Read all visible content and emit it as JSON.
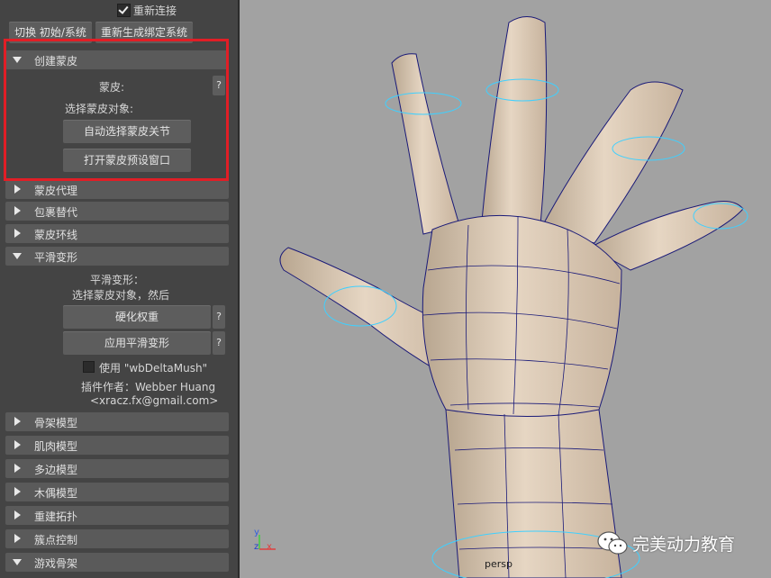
{
  "top": {
    "reconnect_label": "重新连接",
    "switch_button": "切换 初始/系统",
    "regenerate_button": "重新生成绑定系统"
  },
  "sections": {
    "create_skin": {
      "title": "创建蒙皮",
      "skin_label": "蒙皮:",
      "help": "?",
      "select_hint": "选择蒙皮对象:",
      "auto_select_button": "自动选择蒙皮关节",
      "open_preset_button": "打开蒙皮预设窗口"
    },
    "proxy": {
      "title": "蒙皮代理"
    },
    "wrap": {
      "title": "包裹替代"
    },
    "loop": {
      "title": "蒙皮环线"
    },
    "smooth": {
      "title": "平滑变形",
      "line1": "平滑变形：",
      "line2": "选择蒙皮对象，然后",
      "harden_button": "硬化权重",
      "apply_button": "应用平滑变形",
      "help1": "?",
      "help2": "?",
      "use_checkbox_label": "使用 \"wbDeltaMush\"",
      "author_line": "插件作者：Webber Huang",
      "email_line": "<xracz.fx@gmail.com>"
    },
    "collapsed": [
      "骨架模型",
      "肌肉模型",
      "多边模型",
      "木偶模型",
      "重建拓扑",
      "簇点控制",
      "游戏骨架"
    ]
  },
  "viewport": {
    "camera_label": "persp",
    "axis_x": "x",
    "axis_y": "y",
    "axis_z": "z"
  },
  "watermark": {
    "text": "完美动力教育"
  },
  "colors": {
    "highlight_box": "#e11e26",
    "skin": "#dccbb7",
    "wire": "#1a1a78",
    "control_curve": "#3fd0ff"
  }
}
